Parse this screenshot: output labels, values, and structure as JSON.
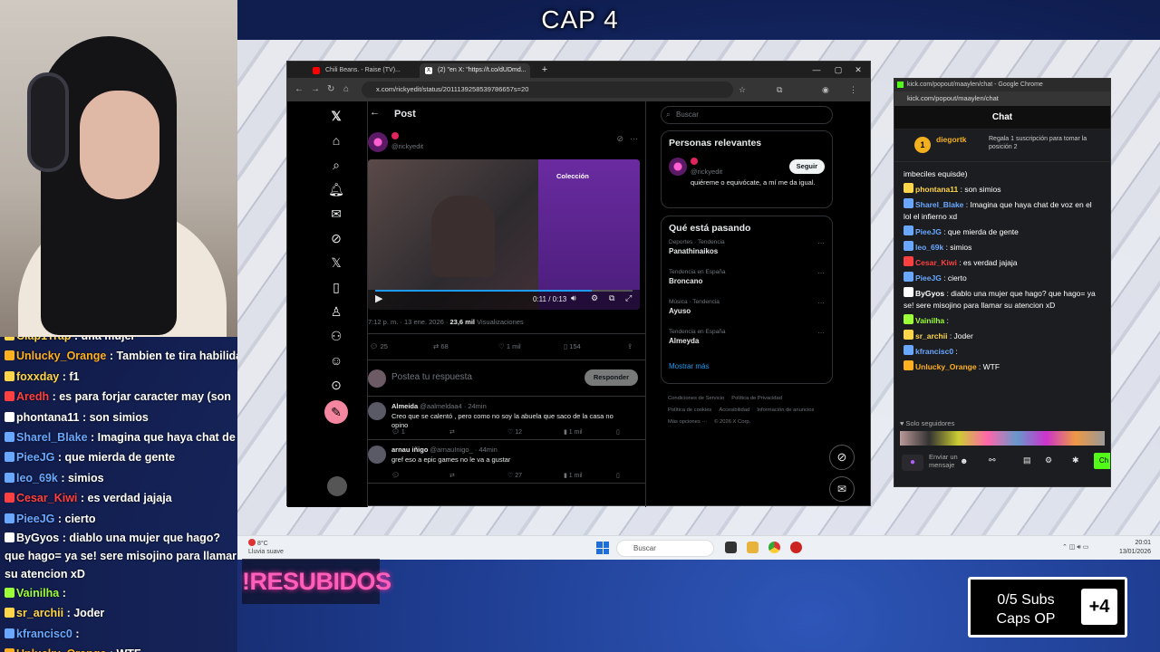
{
  "overlay": {
    "title": "CAP 4",
    "resubidos": "!RESUBIDOS",
    "subs_text": "0/5 Subs Caps OP",
    "subs_badge": "+4"
  },
  "stream_chat": [
    {
      "user": "Clap1Trap",
      "msg": ": una mujer",
      "color": "#ffd54a"
    },
    {
      "user": "Unlucky_Orange",
      "msg": ": Tambien te tira habilidad",
      "color": "#ffb020"
    },
    {
      "user": "foxxday",
      "msg": ": f1",
      "color": "#ffd54a"
    },
    {
      "user": "Aredh",
      "msg": ": es para forjar caracter may (son",
      "color": "#ff4040"
    },
    {
      "user": "phontana11",
      "msg": ": son simios",
      "color": "#ffffff"
    },
    {
      "user": "Sharel_Blake",
      "msg": ": Imagina que haya chat de voz",
      "color": "#6aa8ff"
    },
    {
      "user": "PieeJG",
      "msg": ": que mierda de gente",
      "color": "#6aa8ff"
    },
    {
      "user": "leo_69k",
      "msg": ": simios",
      "color": "#6aa8ff"
    },
    {
      "user": "Cesar_Kiwi",
      "msg": ": es verdad jajaja",
      "color": "#ff4040"
    },
    {
      "user": "PieeJG",
      "msg": ": cierto",
      "color": "#6aa8ff"
    },
    {
      "user": "ByGyos",
      "msg": ": diablo una mujer que hago? que hago= ya se! sere misojino para llamar su atencion xD",
      "color": "#ffffff"
    },
    {
      "user": "Vainilha",
      "msg": ":",
      "color": "#9cff3a"
    },
    {
      "user": "sr_archii",
      "msg": ": Joder",
      "color": "#ffd54a"
    },
    {
      "user": "kfrancisc0",
      "msg": ":",
      "color": "#6aa8ff"
    },
    {
      "user": "Unlucky_Orange",
      "msg": ": WTF",
      "color": "#ffb020"
    }
  ],
  "browser": {
    "tabs": [
      "Chili Beans. - Raise (TV)...",
      "(2) \"en X: \"https://t.co/dUDmd..."
    ],
    "url": "x.com/rickyedit/status/2011139258539786657s=20",
    "win": {
      "min": "—",
      "max": "▢",
      "close": "✕"
    }
  },
  "x": {
    "nav_icons": [
      "x-logo-icon",
      "home-icon",
      "search-icon",
      "notifications-icon",
      "messages-icon",
      "grok-icon",
      "x-premium-icon",
      "bookmarks-icon",
      "jobs-icon",
      "communities-icon",
      "profile-icon",
      "more-icon"
    ],
    "header": "Post",
    "author_handle": "@rickyedit",
    "video_time": "0:11 / 0:13",
    "video_caption": "Colección",
    "post_meta_time": "7:12 p. m. · 13 ene. 2026 ·",
    "post_views": "23,6 mil",
    "post_views_label": "Visualizaciones",
    "stats": {
      "replies": "25",
      "reposts": "68",
      "likes": "1 mil",
      "bookmarks": "154"
    },
    "reply_placeholder": "Postea tu respuesta",
    "reply_button": "Responder",
    "replies": [
      {
        "name": "Almeida",
        "handle": "@aalmeldaa4 · 24min",
        "text": "Creo que se calentó , pero como no soy la abuela que saco de la casa no opino",
        "r": "1",
        "l": "12",
        "v": "1 mil"
      },
      {
        "name": "arnau iñigo",
        "handle": "@arnauInigo_ · 44min",
        "text": "gref eso a epic games no le va a gustar",
        "r": "",
        "l": "27",
        "v": "1 mil"
      }
    ],
    "search_placeholder": "Buscar",
    "relevant_title": "Personas relevantes",
    "relevant_handle": "@rickyedit",
    "relevant_bio": "quiéreme o equivócate, a mí me da igual.",
    "follow": "Seguir",
    "trending_title": "Qué está pasando",
    "trends": [
      {
        "cat": "Deportes · Tendencia",
        "name": "Panathinaikos"
      },
      {
        "cat": "Tendencia en España",
        "name": "Broncano"
      },
      {
        "cat": "Música · Tendencia",
        "name": "Ayuso"
      },
      {
        "cat": "Tendencia en España",
        "name": "Almeyda"
      }
    ],
    "show_more": "Mostrar más",
    "footer": [
      "Condiciones de Servicio",
      "Política de Privacidad",
      "Política de cookies",
      "Accesibilidad",
      "Información de anuncios",
      "Más opciones ···",
      "© 2026 X Corp."
    ]
  },
  "kick": {
    "window_title": "kick.com/popout/maaylen/chat - Google Chrome",
    "url": "kick.com/popout/maaylen/chat",
    "header": "Chat",
    "pinned_user": "diegortk",
    "pinned_rank": "1",
    "pinned_text": "Regala 1 suscripción para tomar la posición 2",
    "messages": [
      {
        "user": "",
        "msg": "imbeciles equisde)",
        "color": "#ffffff"
      },
      {
        "user": "phontana11",
        "msg": ": son simios",
        "color": "#ffd54a"
      },
      {
        "user": "Sharel_Blake",
        "msg": ": Imagina que haya chat de voz en el lol el infierno xd",
        "color": "#6aa8ff"
      },
      {
        "user": "PieeJG",
        "msg": ": que mierda de gente",
        "color": "#6aa8ff"
      },
      {
        "user": "leo_69k",
        "msg": ": simios",
        "color": "#6aa8ff"
      },
      {
        "user": "Cesar_Kiwi",
        "msg": ": es verdad jajaja",
        "color": "#ff4040"
      },
      {
        "user": "PieeJG",
        "msg": ": cierto",
        "color": "#6aa8ff"
      },
      {
        "user": "ByGyos",
        "msg": ": diablo una mujer que hago? que hago= ya se! sere misojino para llamar su atencion xD",
        "color": "#ffffff"
      },
      {
        "user": "Vainilha",
        "msg": ":",
        "color": "#9cff3a"
      },
      {
        "user": "sr_archii",
        "msg": ": Joder",
        "color": "#ffd54a"
      },
      {
        "user": "kfrancisc0",
        "msg": ":",
        "color": "#6aa8ff"
      },
      {
        "user": "Unlucky_Orange",
        "msg": ": WTF",
        "color": "#ffb020"
      }
    ],
    "followers_only": "Solo seguidores",
    "input_placeholder": "Enviar un mensaje",
    "chat_button": "Ch"
  },
  "taskbar": {
    "weather": "Lluvia suave",
    "weather_temp": "8°C",
    "search": "Buscar",
    "time": "20:01",
    "date": "13/01/2026"
  }
}
